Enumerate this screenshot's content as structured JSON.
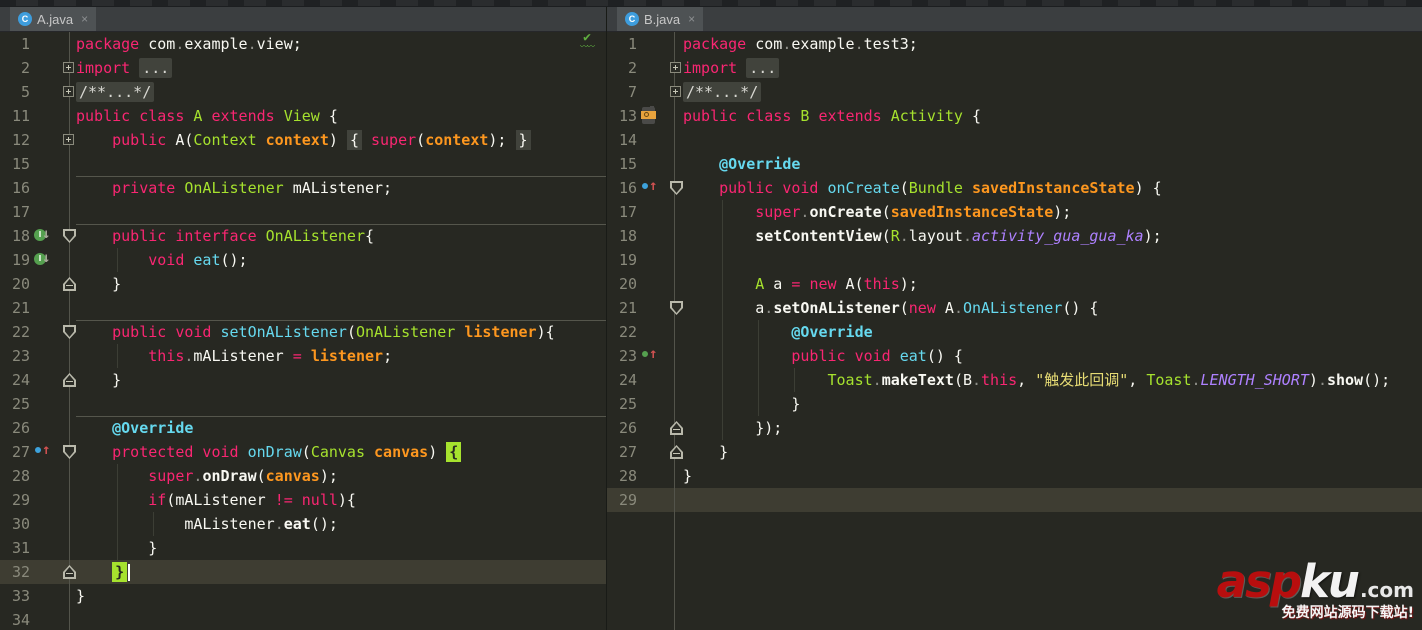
{
  "colors": {
    "editor_background": "#272822",
    "current_line": "#3e3d32",
    "keyword": "#f92672",
    "class_name": "#a6e22e",
    "method_name": "#66d9ef",
    "parameter": "#fd971f",
    "string": "#e6db74",
    "constant": "#ae81ff",
    "plain_text": "#f8f8f2",
    "line_number": "#8a8a7c",
    "tab_active": "#4e5254",
    "tab_bar": "#3b3e40",
    "brace_match": "#a6e22e",
    "watermark_red": "#b80e0e"
  },
  "tabs": {
    "left": {
      "title": "A.java",
      "icon": "C",
      "close": "×"
    },
    "right": {
      "title": "B.java",
      "icon": "C",
      "close": "×"
    }
  },
  "watermark": {
    "brand_red": "asp",
    "brand_white": "ku",
    "tld": ".com",
    "tagline": "免费网站源码下载站!"
  },
  "left_editor": {
    "file": "A.java",
    "inspection": "ok",
    "lines": [
      {
        "n": "1",
        "seg": [
          [
            "kw",
            "package"
          ],
          [
            "pl",
            " com"
          ],
          [
            "dot",
            "."
          ],
          [
            "pl",
            "example"
          ],
          [
            "dot",
            "."
          ],
          [
            "pl",
            "view;"
          ]
        ]
      },
      {
        "n": "2",
        "fold": "plus",
        "seg": [
          [
            "kw",
            "import"
          ],
          [
            "pl",
            " "
          ],
          [
            "fbox",
            "..."
          ]
        ]
      },
      {
        "n": "5",
        "fold": "plus",
        "seg": [
          [
            "fbox",
            "/**...*/"
          ]
        ]
      },
      {
        "n": "11",
        "seg": [
          [
            "kw",
            "public class "
          ],
          [
            "ty",
            "A"
          ],
          [
            "kw",
            " extends "
          ],
          [
            "ty",
            "View"
          ],
          [
            "pl",
            " {"
          ]
        ]
      },
      {
        "n": "12",
        "fold": "plus",
        "seg": [
          [
            "pl",
            "    "
          ],
          [
            "kw",
            "public"
          ],
          [
            "pl",
            " A("
          ],
          [
            "ty",
            "Context"
          ],
          [
            "pl",
            " "
          ],
          [
            "pr",
            "context"
          ],
          [
            "pl",
            ") "
          ],
          [
            "gbrace",
            "{"
          ],
          [
            "pl",
            " "
          ],
          [
            "kw",
            "super"
          ],
          [
            "pl",
            "("
          ],
          [
            "pr",
            "context"
          ],
          [
            "pl",
            "); "
          ],
          [
            "gbrace",
            "}"
          ]
        ]
      },
      {
        "n": "15",
        "seg": []
      },
      {
        "n": "16",
        "sep": true,
        "seg": [
          [
            "pl",
            "    "
          ],
          [
            "kw",
            "private"
          ],
          [
            "pl",
            " "
          ],
          [
            "ty",
            "OnAListener"
          ],
          [
            "pl",
            " mAListener;"
          ]
        ]
      },
      {
        "n": "17",
        "seg": []
      },
      {
        "n": "18",
        "sep": true,
        "fold": "start",
        "gutter": "impl-down",
        "seg": [
          [
            "pl",
            "    "
          ],
          [
            "kw",
            "public interface"
          ],
          [
            "pl",
            " "
          ],
          [
            "ty",
            "OnAListener"
          ],
          [
            "pl",
            "{"
          ]
        ]
      },
      {
        "n": "19",
        "gutter": "impl-down",
        "seg": [
          [
            "pl",
            "        "
          ],
          [
            "kw",
            "void"
          ],
          [
            "pl",
            " "
          ],
          [
            "fn",
            "eat"
          ],
          [
            "pl",
            "();"
          ]
        ]
      },
      {
        "n": "20",
        "fold": "end",
        "seg": [
          [
            "pl",
            "    }"
          ]
        ]
      },
      {
        "n": "21",
        "seg": []
      },
      {
        "n": "22",
        "sep": true,
        "fold": "start",
        "seg": [
          [
            "pl",
            "    "
          ],
          [
            "kw",
            "public void"
          ],
          [
            "pl",
            " "
          ],
          [
            "fn",
            "setOnAListener"
          ],
          [
            "pl",
            "("
          ],
          [
            "ty",
            "OnAListener"
          ],
          [
            "pl",
            " "
          ],
          [
            "pr",
            "listener"
          ],
          [
            "pl",
            "){"
          ]
        ]
      },
      {
        "n": "23",
        "seg": [
          [
            "pl",
            "        "
          ],
          [
            "kw",
            "this"
          ],
          [
            "dot",
            "."
          ],
          [
            "pl",
            "mAListener "
          ],
          [
            "kw",
            "="
          ],
          [
            "pl",
            " "
          ],
          [
            "pr",
            "listener"
          ],
          [
            "pl",
            ";"
          ]
        ]
      },
      {
        "n": "24",
        "fold": "end",
        "seg": [
          [
            "pl",
            "    }"
          ]
        ]
      },
      {
        "n": "25",
        "seg": []
      },
      {
        "n": "26",
        "sep": true,
        "seg": [
          [
            "pl",
            "    "
          ],
          [
            "ann",
            "@Override"
          ]
        ]
      },
      {
        "n": "27",
        "fold": "start",
        "gutter": "override",
        "seg": [
          [
            "pl",
            "    "
          ],
          [
            "kw",
            "protected void"
          ],
          [
            "pl",
            " "
          ],
          [
            "fn",
            "onDraw"
          ],
          [
            "pl",
            "("
          ],
          [
            "ty",
            "Canvas"
          ],
          [
            "pl",
            " "
          ],
          [
            "pr",
            "canvas"
          ],
          [
            "pl",
            ") "
          ],
          [
            "hbrace",
            "{"
          ]
        ]
      },
      {
        "n": "28",
        "seg": [
          [
            "pl",
            "        "
          ],
          [
            "kw",
            "super"
          ],
          [
            "dot",
            "."
          ],
          [
            "bd",
            "onDraw"
          ],
          [
            "pl",
            "("
          ],
          [
            "pr",
            "canvas"
          ],
          [
            "pl",
            ");"
          ]
        ]
      },
      {
        "n": "29",
        "seg": [
          [
            "pl",
            "        "
          ],
          [
            "kw",
            "if"
          ],
          [
            "pl",
            "(mAListener "
          ],
          [
            "kw",
            "!="
          ],
          [
            "pl",
            " "
          ],
          [
            "kw",
            "null"
          ],
          [
            "pl",
            "){"
          ]
        ]
      },
      {
        "n": "30",
        "seg": [
          [
            "pl",
            "            mAListener"
          ],
          [
            "dot",
            "."
          ],
          [
            "bd",
            "eat"
          ],
          [
            "pl",
            "();"
          ]
        ]
      },
      {
        "n": "31",
        "seg": [
          [
            "pl",
            "        }"
          ]
        ]
      },
      {
        "n": "32",
        "cur": true,
        "caret": true,
        "fold": "end",
        "seg": [
          [
            "pl",
            "    "
          ],
          [
            "hbrace",
            "}"
          ]
        ]
      },
      {
        "n": "33",
        "seg": [
          [
            "pl",
            "}"
          ]
        ]
      },
      {
        "n": "34",
        "seg": []
      }
    ]
  },
  "right_editor": {
    "file": "B.java",
    "lines": [
      {
        "n": "1",
        "seg": [
          [
            "kw",
            "package"
          ],
          [
            "pl",
            " com"
          ],
          [
            "dot",
            "."
          ],
          [
            "pl",
            "example"
          ],
          [
            "dot",
            "."
          ],
          [
            "pl",
            "test3;"
          ]
        ]
      },
      {
        "n": "2",
        "fold": "plus",
        "seg": [
          [
            "kw",
            "import"
          ],
          [
            "pl",
            " "
          ],
          [
            "fbox",
            "..."
          ]
        ]
      },
      {
        "n": "7",
        "fold": "plus",
        "seg": [
          [
            "fbox",
            "/**...*/"
          ]
        ]
      },
      {
        "n": "13",
        "gutter": "android",
        "seg": [
          [
            "kw",
            "public class "
          ],
          [
            "ty",
            "B"
          ],
          [
            "kw",
            " extends "
          ],
          [
            "ty",
            "Activity"
          ],
          [
            "pl",
            " {"
          ]
        ]
      },
      {
        "n": "14",
        "seg": []
      },
      {
        "n": "15",
        "seg": [
          [
            "pl",
            "    "
          ],
          [
            "ann",
            "@Override"
          ]
        ]
      },
      {
        "n": "16",
        "fold": "start",
        "gutter": "override",
        "seg": [
          [
            "pl",
            "    "
          ],
          [
            "kw",
            "public void"
          ],
          [
            "pl",
            " "
          ],
          [
            "fn",
            "onCreate"
          ],
          [
            "pl",
            "("
          ],
          [
            "ty",
            "Bundle"
          ],
          [
            "pl",
            " "
          ],
          [
            "pr",
            "savedInstanceState"
          ],
          [
            "pl",
            ") {"
          ]
        ]
      },
      {
        "n": "17",
        "seg": [
          [
            "pl",
            "        "
          ],
          [
            "kw",
            "super"
          ],
          [
            "dot",
            "."
          ],
          [
            "bd",
            "onCreate"
          ],
          [
            "pl",
            "("
          ],
          [
            "pr",
            "savedInstanceState"
          ],
          [
            "pl",
            ");"
          ]
        ]
      },
      {
        "n": "18",
        "seg": [
          [
            "pl",
            "        "
          ],
          [
            "bd",
            "setContentView"
          ],
          [
            "pl",
            "("
          ],
          [
            "ty",
            "R"
          ],
          [
            "dot",
            "."
          ],
          [
            "pl",
            "layout"
          ],
          [
            "dot",
            "."
          ],
          [
            "cn",
            "activity_gua_gua_ka"
          ],
          [
            "pl",
            ");"
          ]
        ]
      },
      {
        "n": "19",
        "seg": []
      },
      {
        "n": "20",
        "seg": [
          [
            "pl",
            "        "
          ],
          [
            "ty",
            "A"
          ],
          [
            "pl",
            " a "
          ],
          [
            "kw",
            "="
          ],
          [
            "pl",
            " "
          ],
          [
            "kw",
            "new"
          ],
          [
            "pl",
            " A("
          ],
          [
            "kw",
            "this"
          ],
          [
            "pl",
            ");"
          ]
        ]
      },
      {
        "n": "21",
        "fold": "start",
        "seg": [
          [
            "pl",
            "        a"
          ],
          [
            "dot",
            "."
          ],
          [
            "bd",
            "setOnAListener"
          ],
          [
            "pl",
            "("
          ],
          [
            "kw",
            "new"
          ],
          [
            "pl",
            " A"
          ],
          [
            "dot",
            "."
          ],
          [
            "fn",
            "OnAListener"
          ],
          [
            "pl",
            "() {"
          ]
        ]
      },
      {
        "n": "22",
        "seg": [
          [
            "pl",
            "            "
          ],
          [
            "ann",
            "@Override"
          ]
        ]
      },
      {
        "n": "23",
        "gutter": "impl-up",
        "seg": [
          [
            "pl",
            "            "
          ],
          [
            "kw",
            "public void"
          ],
          [
            "pl",
            " "
          ],
          [
            "fn",
            "eat"
          ],
          [
            "pl",
            "() {"
          ]
        ]
      },
      {
        "n": "24",
        "seg": [
          [
            "pl",
            "                "
          ],
          [
            "ty",
            "Toast"
          ],
          [
            "dot",
            "."
          ],
          [
            "bd",
            "makeText"
          ],
          [
            "pl",
            "(B"
          ],
          [
            "dot",
            "."
          ],
          [
            "kw",
            "this"
          ],
          [
            "pl",
            ", "
          ],
          [
            "st",
            "\"触发此回调\""
          ],
          [
            "pl",
            ", "
          ],
          [
            "ty",
            "Toast"
          ],
          [
            "dot",
            "."
          ],
          [
            "cn",
            "LENGTH_SHORT"
          ],
          [
            "pl",
            ")"
          ],
          [
            "dot",
            "."
          ],
          [
            "bd",
            "show"
          ],
          [
            "pl",
            "();"
          ]
        ]
      },
      {
        "n": "25",
        "seg": [
          [
            "pl",
            "            }"
          ]
        ]
      },
      {
        "n": "26",
        "fold": "end",
        "seg": [
          [
            "pl",
            "        });"
          ]
        ]
      },
      {
        "n": "27",
        "fold": "end",
        "seg": [
          [
            "pl",
            "    }"
          ]
        ]
      },
      {
        "n": "28",
        "seg": [
          [
            "pl",
            "}"
          ]
        ]
      },
      {
        "n": "29",
        "cur": true,
        "seg": []
      }
    ]
  }
}
